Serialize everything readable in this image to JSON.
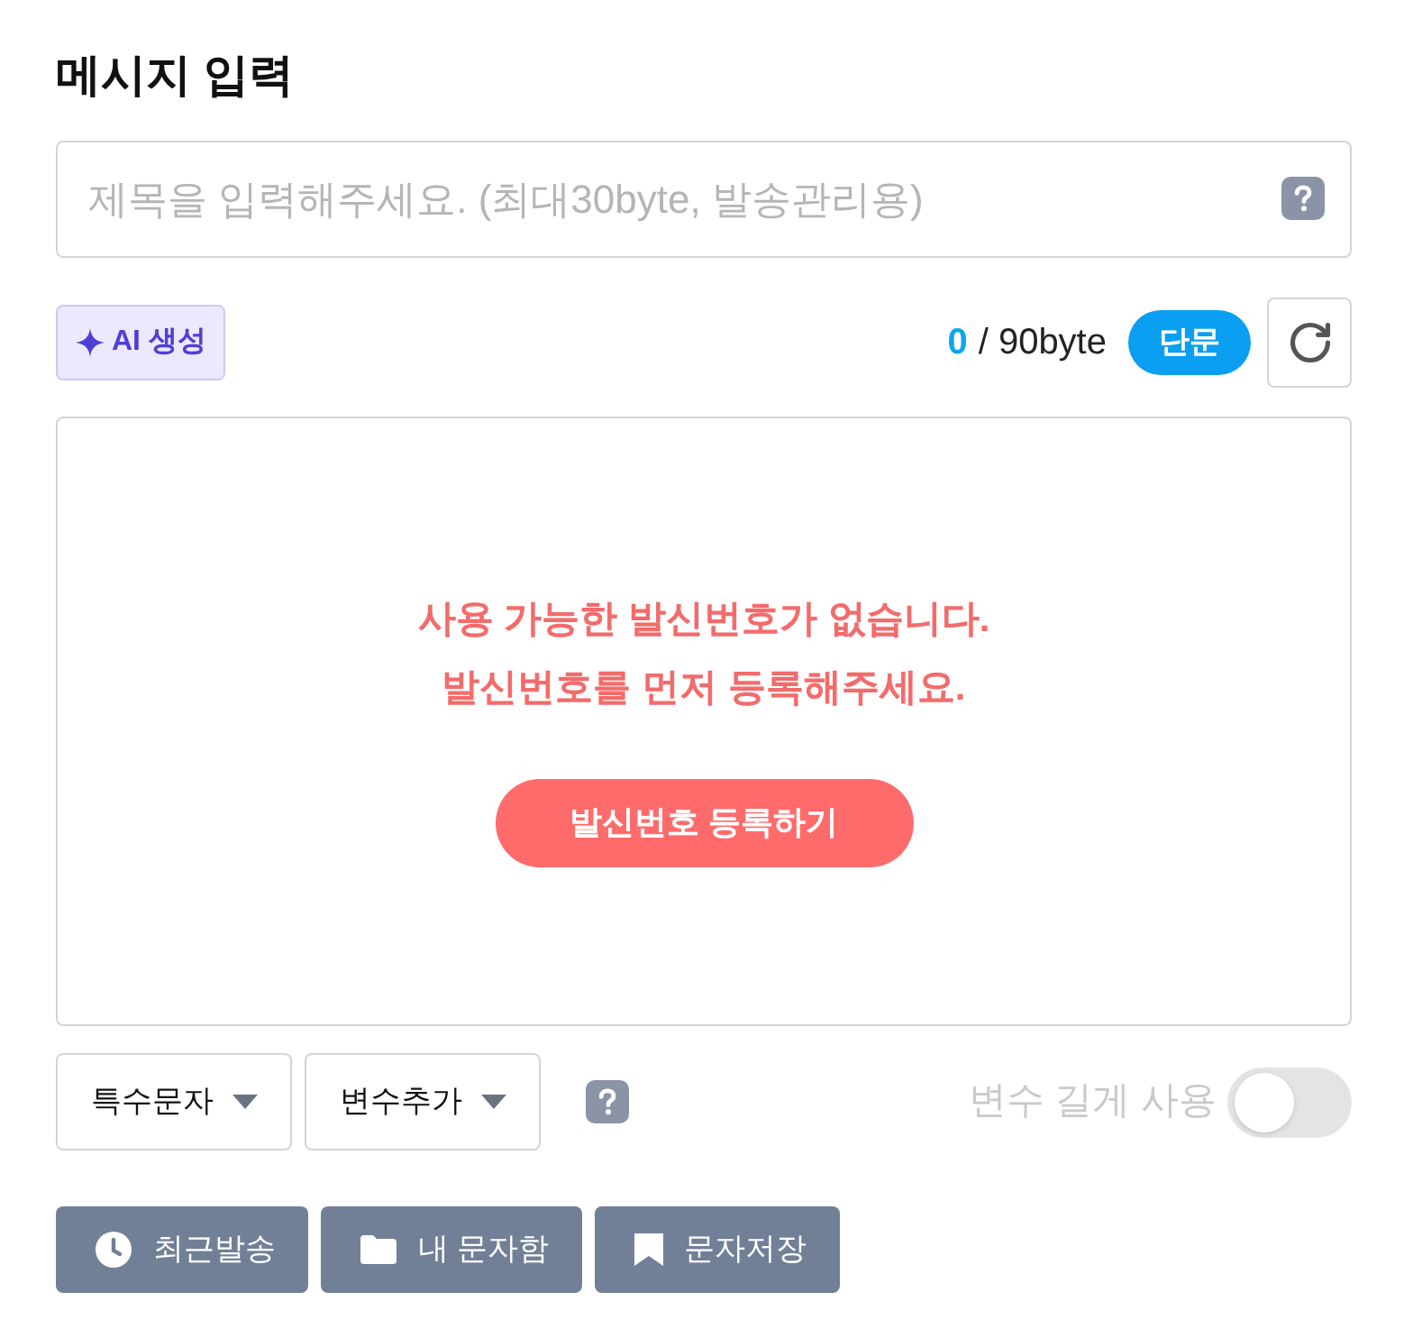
{
  "title": "메시지 입력",
  "subject_field": {
    "placeholder": "제목을 입력해주세요. (최대30byte, 발송관리용)"
  },
  "ai_button": {
    "label": "AI 생성"
  },
  "byte_counter": {
    "count": "0",
    "limit": "/ 90byte"
  },
  "message_type": "단문",
  "notice": {
    "lines": [
      "사용 가능한 발신번호가 없습니다.",
      "발신번호를 먼저 등록해주세요."
    ],
    "button": "발신번호 등록하기"
  },
  "dropdowns": [
    "특수문자",
    "변수추가"
  ],
  "long_variable_toggle": {
    "label": "변수 길게 사용",
    "on": false
  },
  "actions": [
    {
      "kind": "recent",
      "label": "최근발송"
    },
    {
      "kind": "inbox",
      "label": "내 문자함"
    },
    {
      "kind": "save",
      "label": "문자저장"
    }
  ]
}
